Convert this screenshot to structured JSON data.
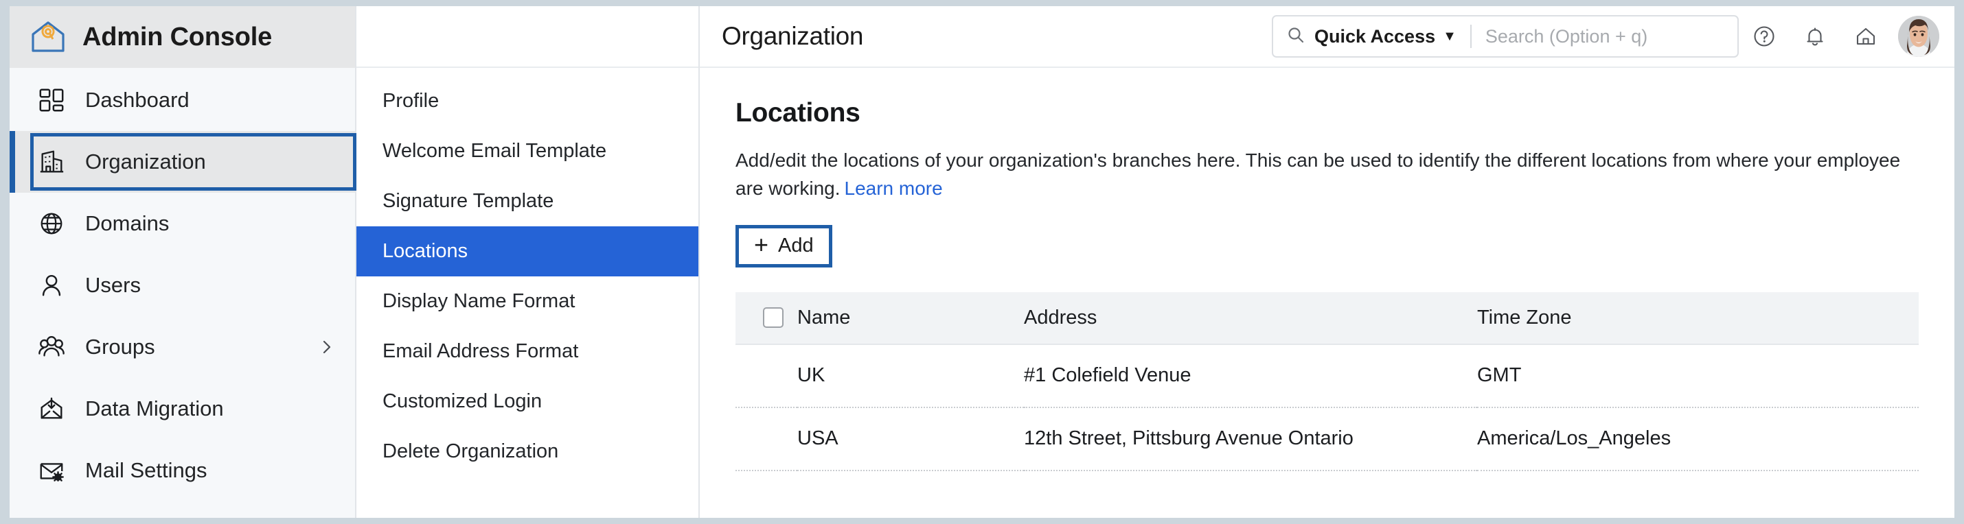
{
  "brand": {
    "title": "Admin Console",
    "logo_icon": "house-gear-icon"
  },
  "sidebar": {
    "items": [
      {
        "label": "Dashboard",
        "icon": "dashboard-grid-icon",
        "active": false,
        "chevron": false
      },
      {
        "label": "Organization",
        "icon": "building-icon",
        "active": true,
        "chevron": false
      },
      {
        "label": "Domains",
        "icon": "globe-icon",
        "active": false,
        "chevron": false
      },
      {
        "label": "Users",
        "icon": "user-icon",
        "active": false,
        "chevron": false
      },
      {
        "label": "Groups",
        "icon": "users-group-icon",
        "active": false,
        "chevron": true
      },
      {
        "label": "Data Migration",
        "icon": "envelope-download-icon",
        "active": false,
        "chevron": false
      },
      {
        "label": "Mail Settings",
        "icon": "envelope-gear-icon",
        "active": false,
        "chevron": false
      }
    ]
  },
  "subnav": {
    "items": [
      {
        "label": "Profile",
        "active": false
      },
      {
        "label": "Welcome Email Template",
        "active": false
      },
      {
        "label": "Signature Template",
        "active": false
      },
      {
        "label": "Locations",
        "active": true
      },
      {
        "label": "Display Name Format",
        "active": false
      },
      {
        "label": "Email Address Format",
        "active": false
      },
      {
        "label": "Customized Login",
        "active": false
      },
      {
        "label": "Delete Organization",
        "active": false
      }
    ]
  },
  "topbar": {
    "page_title": "Organization",
    "quick_access_label": "Quick Access",
    "quick_access_caret": "▼",
    "search_placeholder": "Search (Option + q)",
    "search_value": "",
    "search_icon": "search-icon",
    "help_icon": "help-circle-icon",
    "notifications_icon": "bell-icon",
    "home_icon": "home-icon",
    "avatar_icon": "user-avatar"
  },
  "main": {
    "title": "Locations",
    "description": "Add/edit the locations of your organization's branches here. This can be used to identify the different locations from where your employee are working.",
    "learn_more_label": "Learn more",
    "add_button_label": "Add",
    "add_button_plus": "+",
    "table": {
      "columns": [
        "Name",
        "Address",
        "Time Zone"
      ],
      "rows": [
        {
          "name": "UK",
          "address": "#1 Colefield Venue",
          "timezone": "GMT"
        },
        {
          "name": "USA",
          "address": "12th Street, Pittsburg Avenue Ontario",
          "timezone": "America/Los_Angeles"
        }
      ]
    }
  },
  "colors": {
    "accent_blue": "#2563d6",
    "focus_blue": "#1f5ea8",
    "sidebar_bg": "#f6f8fa",
    "brand_bg": "#e6e7e8",
    "table_header_bg": "#f1f3f5",
    "logo_house": "#3a76b8",
    "logo_gear": "#f0a93c"
  }
}
